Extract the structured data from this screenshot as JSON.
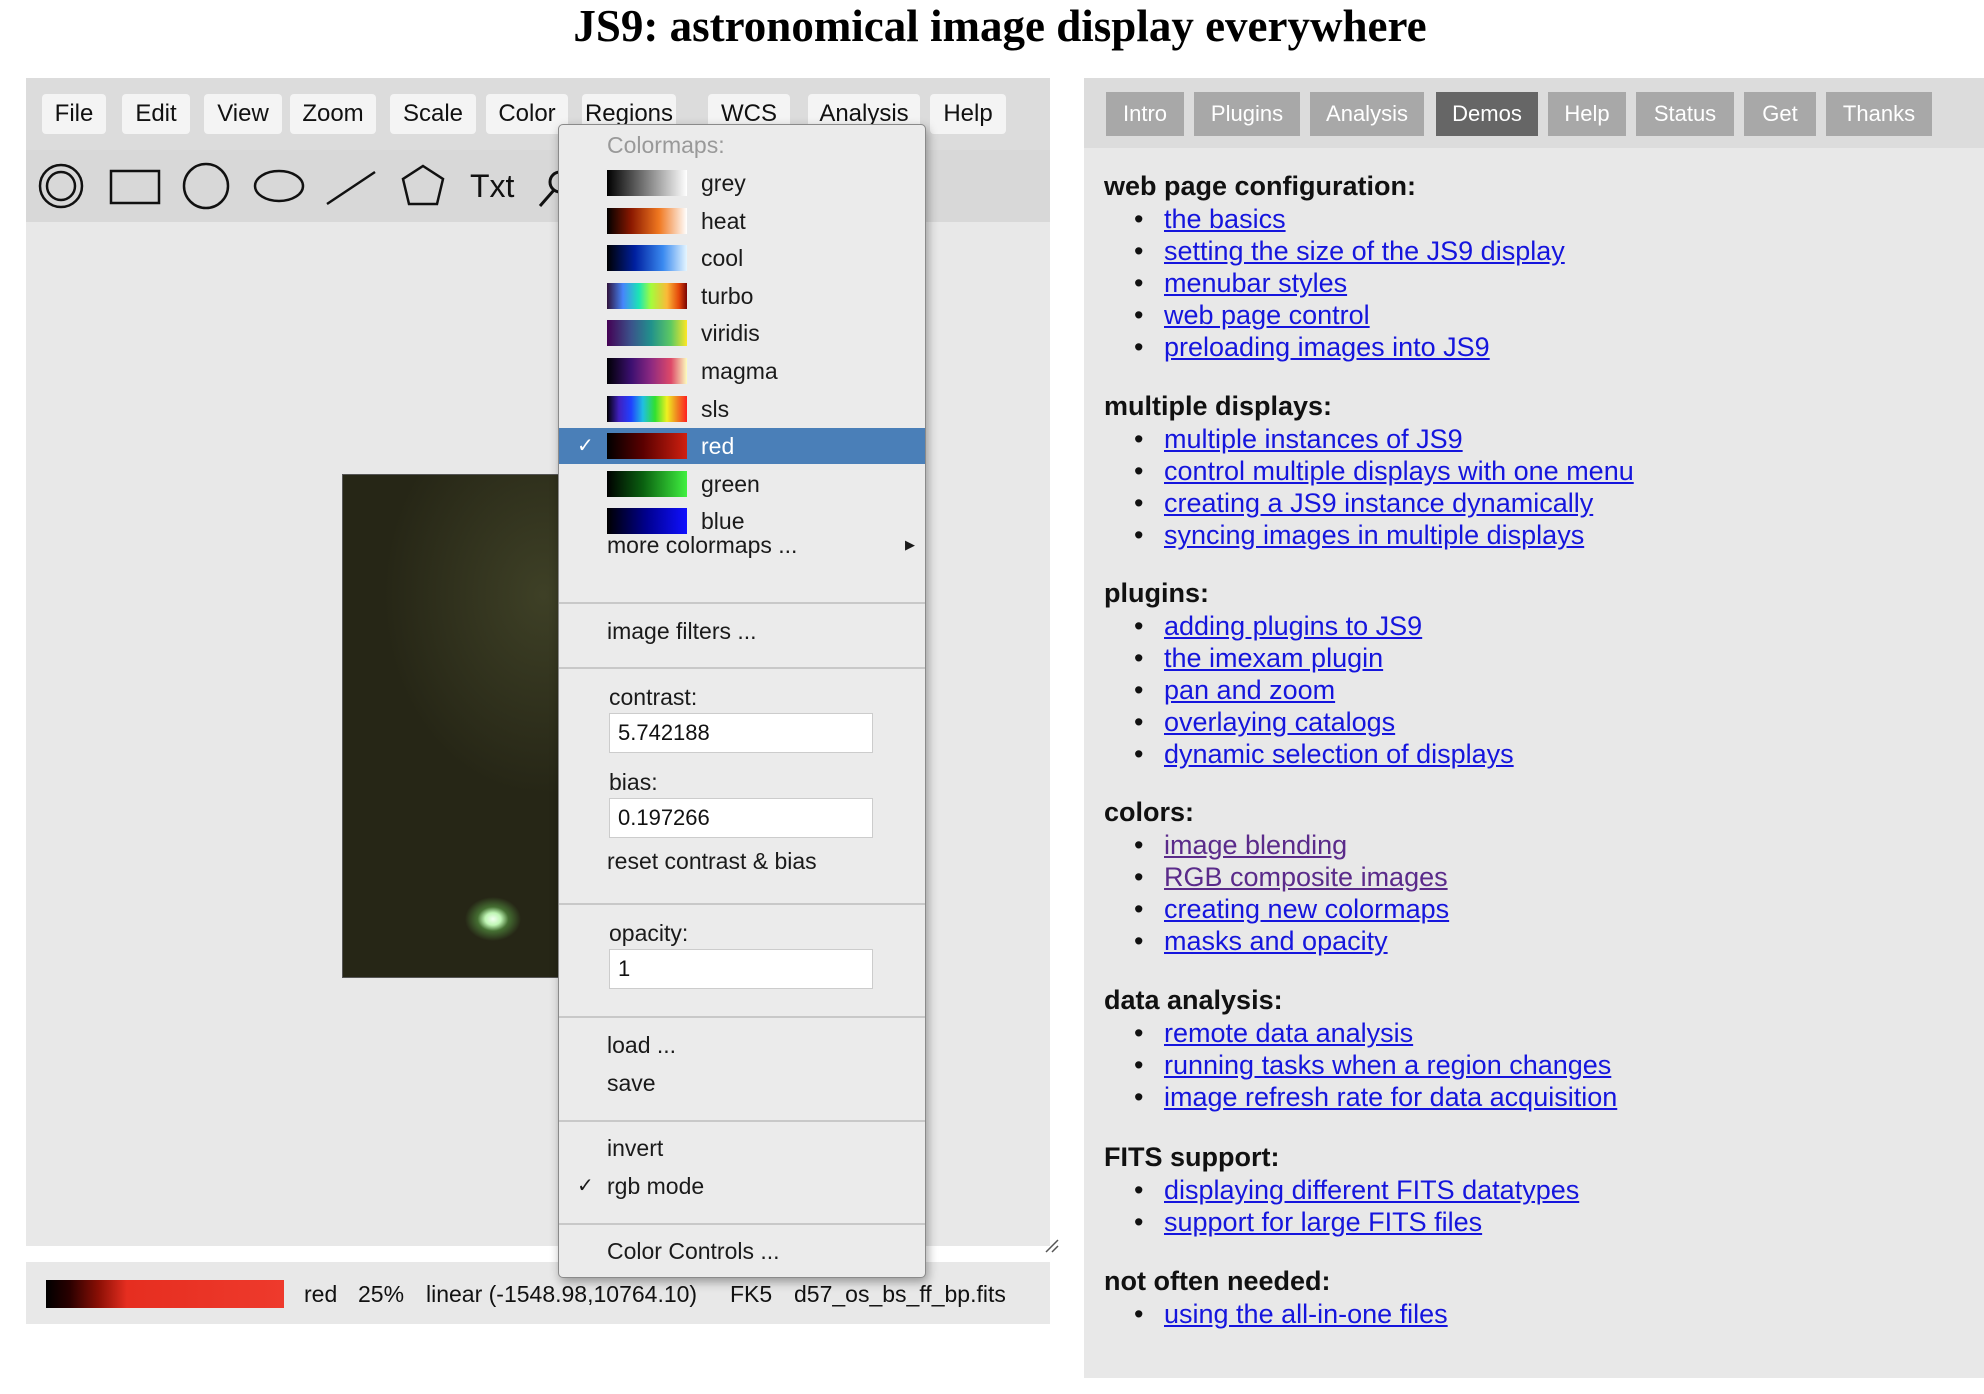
{
  "page": {
    "title": "JS9: astronomical image display everywhere"
  },
  "menubar": [
    "File",
    "Edit",
    "View",
    "Zoom",
    "Scale",
    "Color",
    "Regions",
    "WCS",
    "Analysis",
    "Help"
  ],
  "toolbar": {
    "text_tool": "Txt"
  },
  "color_menu": {
    "header": "Colormaps:",
    "colormaps": [
      {
        "name": "grey",
        "gradient": "linear-gradient(to right,#000,#fff)"
      },
      {
        "name": "heat",
        "gradient": "linear-gradient(to right,#000,#8a1800 30%,#f07820 65%,#fff)"
      },
      {
        "name": "cool",
        "gradient": "linear-gradient(to right,#000,#0020a0 35%,#3a8af0 70%,#e6f6ff)"
      },
      {
        "name": "turbo",
        "gradient": "linear-gradient(to right,#30123b,#4686fb 20%,#1be5b5 40%,#a4fc3c 55%,#fbb938 75%,#e4460a 90%,#7a0403)"
      },
      {
        "name": "viridis",
        "gradient": "linear-gradient(to right,#440154,#3b528b 30%,#21918c 55%,#5ec962 80%,#fde725)"
      },
      {
        "name": "magma",
        "gradient": "linear-gradient(to right,#000004,#3b0f70 30%,#8c2981 55%,#de4968 80%,#fcfdbf)"
      },
      {
        "name": "sls",
        "gradient": "linear-gradient(to right,#000,#4020c0 15%,#2040ff 30%,#20c0e0 45%,#30e030 60%,#f0f020 75%,#f08020 88%,#ff2020)"
      },
      {
        "name": "red",
        "gradient": "linear-gradient(to right,#000,#5a0000 45%,#d02010)",
        "selected": true
      },
      {
        "name": "green",
        "gradient": "linear-gradient(to right,#000,#0a6010 45%,#40f040)"
      },
      {
        "name": "blue",
        "gradient": "linear-gradient(to right,#000,#000090 50%,#1010ff)"
      }
    ],
    "more_colormaps": "more colormaps ...",
    "image_filters": "image filters ...",
    "contrast_label": "contrast:",
    "contrast_value": "5.742188",
    "bias_label": "bias:",
    "bias_value": "0.197266",
    "reset": "reset contrast & bias",
    "opacity_label": "opacity:",
    "opacity_value": "1",
    "load": "load ...",
    "save": "save",
    "invert": "invert",
    "rgb_mode": "rgb mode",
    "color_controls": "Color Controls ..."
  },
  "colorbar": {
    "colormap": "red",
    "zoom": "25%",
    "scale": "linear (-1548.98,10764.10)",
    "wcs": "FK5",
    "file": "d57_os_bs_ff_bp.fits"
  },
  "tabs": [
    {
      "label": "Intro"
    },
    {
      "label": "Plugins"
    },
    {
      "label": "Analysis"
    },
    {
      "label": "Demos",
      "active": true
    },
    {
      "label": "Help"
    },
    {
      "label": "Status"
    },
    {
      "label": "Get"
    },
    {
      "label": "Thanks"
    }
  ],
  "sections": [
    {
      "title": "web page configuration:",
      "links": [
        {
          "text": "the basics"
        },
        {
          "text": "setting the size of the JS9 display"
        },
        {
          "text": "menubar styles"
        },
        {
          "text": "web page control"
        },
        {
          "text": "preloading images into JS9"
        }
      ]
    },
    {
      "title": "multiple displays:",
      "links": [
        {
          "text": "multiple instances of JS9"
        },
        {
          "text": "control multiple displays with one menu"
        },
        {
          "text": "creating a JS9 instance dynamically"
        },
        {
          "text": "syncing images in multiple displays"
        }
      ]
    },
    {
      "title": "plugins:",
      "links": [
        {
          "text": "adding plugins to JS9"
        },
        {
          "text": "the imexam plugin"
        },
        {
          "text": "pan and zoom"
        },
        {
          "text": "overlaying catalogs"
        },
        {
          "text": "dynamic selection of displays"
        }
      ]
    },
    {
      "title": "colors:",
      "links": [
        {
          "text": "image blending",
          "visited": true
        },
        {
          "text": "RGB composite images",
          "visited": true
        },
        {
          "text": "creating new colormaps"
        },
        {
          "text": "masks and opacity"
        }
      ]
    },
    {
      "title": "data analysis:",
      "links": [
        {
          "text": "remote data analysis"
        },
        {
          "text": "running tasks when a region changes"
        },
        {
          "text": "image refresh rate for data acquisition"
        }
      ]
    },
    {
      "title": "FITS support:",
      "links": [
        {
          "text": "displaying different FITS datatypes"
        },
        {
          "text": "support for large FITS files"
        }
      ]
    },
    {
      "title": "not often needed:",
      "links": [
        {
          "text": "using the all-in-one files"
        }
      ]
    }
  ]
}
